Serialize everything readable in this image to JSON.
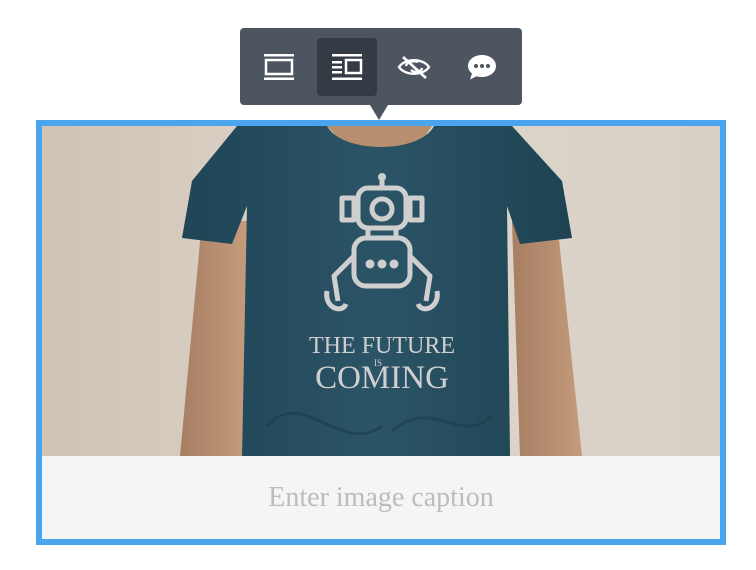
{
  "toolbar": {
    "buttons": [
      {
        "name": "align-center",
        "icon": "image-full-width-icon",
        "active": false
      },
      {
        "name": "align-text-wrap",
        "icon": "image-text-wrap-icon",
        "active": true
      },
      {
        "name": "hide",
        "icon": "eye-slash-icon",
        "active": false
      },
      {
        "name": "caption",
        "icon": "comment-bubble-icon",
        "active": false
      }
    ]
  },
  "image": {
    "shirt_text_line1": "THE FUTURE",
    "shirt_text_small": "IS",
    "shirt_text_line2": "COMING"
  },
  "caption": {
    "placeholder": "Enter image caption"
  },
  "colors": {
    "selection_border": "#4ba4ee",
    "toolbar_bg": "#4d5561",
    "toolbar_active": "#343b45",
    "caption_text": "#bcbcbc"
  }
}
